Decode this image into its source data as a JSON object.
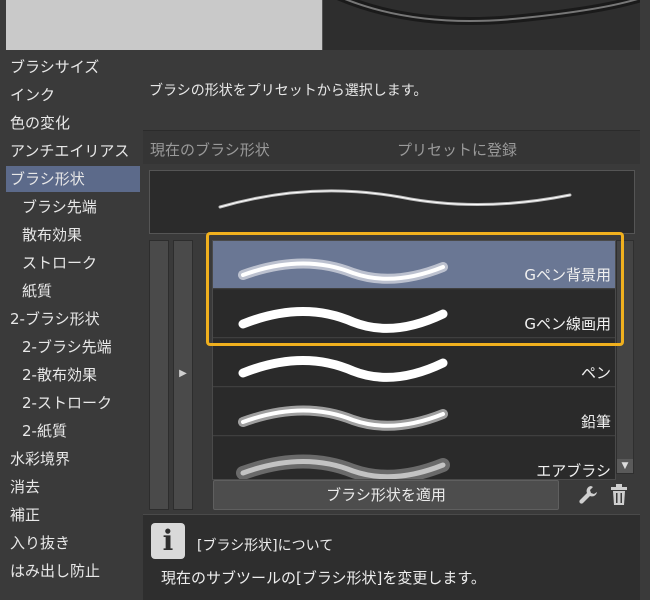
{
  "nav": {
    "items": [
      {
        "label": "ブラシサイズ",
        "indent": false,
        "active": false
      },
      {
        "label": "インク",
        "indent": false,
        "active": false
      },
      {
        "label": "色の変化",
        "indent": false,
        "active": false
      },
      {
        "label": "アンチエイリアス",
        "indent": false,
        "active": false
      },
      {
        "label": "ブラシ形状",
        "indent": false,
        "active": true
      },
      {
        "label": "ブラシ先端",
        "indent": true,
        "active": false
      },
      {
        "label": "散布効果",
        "indent": true,
        "active": false
      },
      {
        "label": "ストローク",
        "indent": true,
        "active": false
      },
      {
        "label": "紙質",
        "indent": true,
        "active": false
      },
      {
        "label": "2-ブラシ形状",
        "indent": false,
        "active": false
      },
      {
        "label": "2-ブラシ先端",
        "indent": true,
        "active": false
      },
      {
        "label": "2-散布効果",
        "indent": true,
        "active": false
      },
      {
        "label": "2-ストローク",
        "indent": true,
        "active": false
      },
      {
        "label": "2-紙質",
        "indent": true,
        "active": false
      },
      {
        "label": "水彩境界",
        "indent": false,
        "active": false
      },
      {
        "label": "消去",
        "indent": false,
        "active": false
      },
      {
        "label": "補正",
        "indent": false,
        "active": false
      },
      {
        "label": "入り抜き",
        "indent": false,
        "active": false
      },
      {
        "label": "はみ出し防止",
        "indent": false,
        "active": false
      }
    ]
  },
  "description": "ブラシの形状をプリセットから選択します。",
  "header": {
    "current_shape": "現在のブラシ形状",
    "register_preset": "プリセットに登録"
  },
  "presets": [
    {
      "label": "Gペン背景用",
      "selected": true,
      "stroke": "soft"
    },
    {
      "label": "Gペン線画用",
      "selected": false,
      "stroke": "solid"
    },
    {
      "label": "ペン",
      "selected": false,
      "stroke": "solid"
    },
    {
      "label": "鉛筆",
      "selected": false,
      "stroke": "soft"
    },
    {
      "label": "エアブラシ",
      "selected": false,
      "stroke": "airbrush"
    }
  ],
  "apply_button": "ブラシ形状を適用",
  "info": {
    "icon_glyph": "i",
    "title": "[ブラシ形状]について",
    "body": "現在のサブツールの[ブラシ形状]を変更します。"
  },
  "colors": {
    "highlight": "#f0b01e",
    "active_nav": "#5c6a8a",
    "selected_preset": "#6a7794"
  }
}
